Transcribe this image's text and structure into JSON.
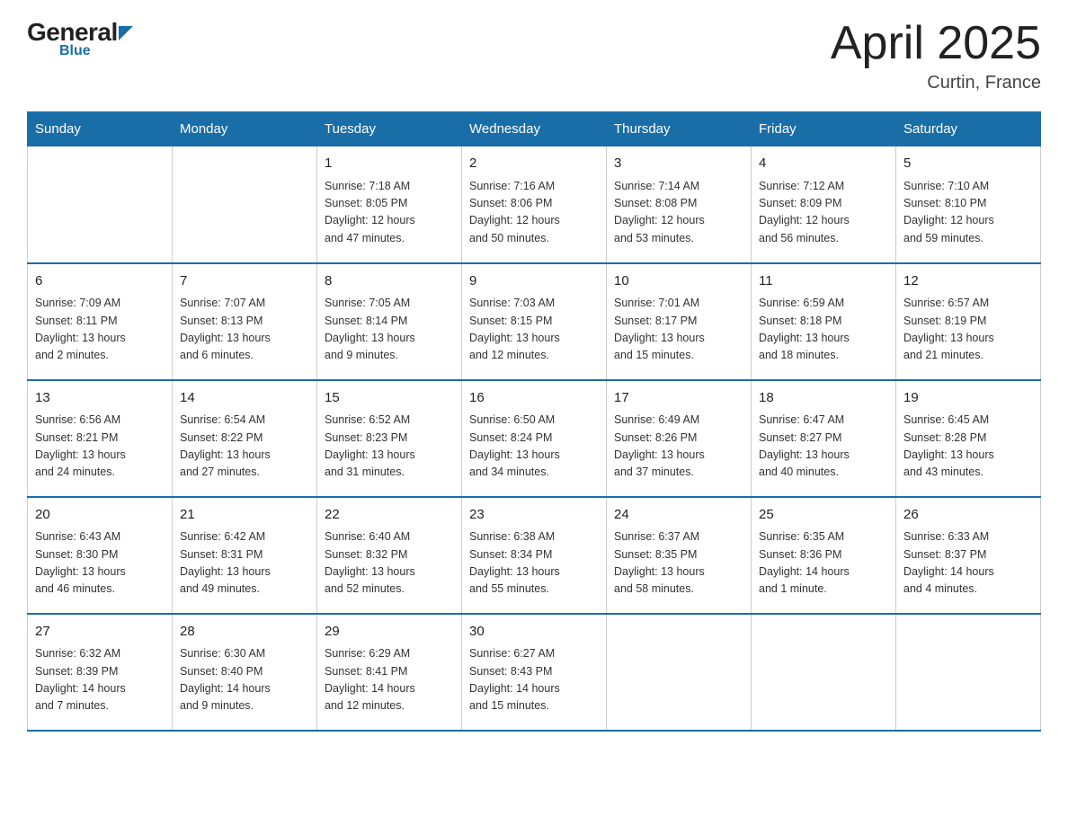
{
  "header": {
    "month_title": "April 2025",
    "location": "Curtin, France"
  },
  "days_of_week": [
    "Sunday",
    "Monday",
    "Tuesday",
    "Wednesday",
    "Thursday",
    "Friday",
    "Saturday"
  ],
  "weeks": [
    [
      {
        "day": "",
        "info": ""
      },
      {
        "day": "",
        "info": ""
      },
      {
        "day": "1",
        "info": "Sunrise: 7:18 AM\nSunset: 8:05 PM\nDaylight: 12 hours\nand 47 minutes."
      },
      {
        "day": "2",
        "info": "Sunrise: 7:16 AM\nSunset: 8:06 PM\nDaylight: 12 hours\nand 50 minutes."
      },
      {
        "day": "3",
        "info": "Sunrise: 7:14 AM\nSunset: 8:08 PM\nDaylight: 12 hours\nand 53 minutes."
      },
      {
        "day": "4",
        "info": "Sunrise: 7:12 AM\nSunset: 8:09 PM\nDaylight: 12 hours\nand 56 minutes."
      },
      {
        "day": "5",
        "info": "Sunrise: 7:10 AM\nSunset: 8:10 PM\nDaylight: 12 hours\nand 59 minutes."
      }
    ],
    [
      {
        "day": "6",
        "info": "Sunrise: 7:09 AM\nSunset: 8:11 PM\nDaylight: 13 hours\nand 2 minutes."
      },
      {
        "day": "7",
        "info": "Sunrise: 7:07 AM\nSunset: 8:13 PM\nDaylight: 13 hours\nand 6 minutes."
      },
      {
        "day": "8",
        "info": "Sunrise: 7:05 AM\nSunset: 8:14 PM\nDaylight: 13 hours\nand 9 minutes."
      },
      {
        "day": "9",
        "info": "Sunrise: 7:03 AM\nSunset: 8:15 PM\nDaylight: 13 hours\nand 12 minutes."
      },
      {
        "day": "10",
        "info": "Sunrise: 7:01 AM\nSunset: 8:17 PM\nDaylight: 13 hours\nand 15 minutes."
      },
      {
        "day": "11",
        "info": "Sunrise: 6:59 AM\nSunset: 8:18 PM\nDaylight: 13 hours\nand 18 minutes."
      },
      {
        "day": "12",
        "info": "Sunrise: 6:57 AM\nSunset: 8:19 PM\nDaylight: 13 hours\nand 21 minutes."
      }
    ],
    [
      {
        "day": "13",
        "info": "Sunrise: 6:56 AM\nSunset: 8:21 PM\nDaylight: 13 hours\nand 24 minutes."
      },
      {
        "day": "14",
        "info": "Sunrise: 6:54 AM\nSunset: 8:22 PM\nDaylight: 13 hours\nand 27 minutes."
      },
      {
        "day": "15",
        "info": "Sunrise: 6:52 AM\nSunset: 8:23 PM\nDaylight: 13 hours\nand 31 minutes."
      },
      {
        "day": "16",
        "info": "Sunrise: 6:50 AM\nSunset: 8:24 PM\nDaylight: 13 hours\nand 34 minutes."
      },
      {
        "day": "17",
        "info": "Sunrise: 6:49 AM\nSunset: 8:26 PM\nDaylight: 13 hours\nand 37 minutes."
      },
      {
        "day": "18",
        "info": "Sunrise: 6:47 AM\nSunset: 8:27 PM\nDaylight: 13 hours\nand 40 minutes."
      },
      {
        "day": "19",
        "info": "Sunrise: 6:45 AM\nSunset: 8:28 PM\nDaylight: 13 hours\nand 43 minutes."
      }
    ],
    [
      {
        "day": "20",
        "info": "Sunrise: 6:43 AM\nSunset: 8:30 PM\nDaylight: 13 hours\nand 46 minutes."
      },
      {
        "day": "21",
        "info": "Sunrise: 6:42 AM\nSunset: 8:31 PM\nDaylight: 13 hours\nand 49 minutes."
      },
      {
        "day": "22",
        "info": "Sunrise: 6:40 AM\nSunset: 8:32 PM\nDaylight: 13 hours\nand 52 minutes."
      },
      {
        "day": "23",
        "info": "Sunrise: 6:38 AM\nSunset: 8:34 PM\nDaylight: 13 hours\nand 55 minutes."
      },
      {
        "day": "24",
        "info": "Sunrise: 6:37 AM\nSunset: 8:35 PM\nDaylight: 13 hours\nand 58 minutes."
      },
      {
        "day": "25",
        "info": "Sunrise: 6:35 AM\nSunset: 8:36 PM\nDaylight: 14 hours\nand 1 minute."
      },
      {
        "day": "26",
        "info": "Sunrise: 6:33 AM\nSunset: 8:37 PM\nDaylight: 14 hours\nand 4 minutes."
      }
    ],
    [
      {
        "day": "27",
        "info": "Sunrise: 6:32 AM\nSunset: 8:39 PM\nDaylight: 14 hours\nand 7 minutes."
      },
      {
        "day": "28",
        "info": "Sunrise: 6:30 AM\nSunset: 8:40 PM\nDaylight: 14 hours\nand 9 minutes."
      },
      {
        "day": "29",
        "info": "Sunrise: 6:29 AM\nSunset: 8:41 PM\nDaylight: 14 hours\nand 12 minutes."
      },
      {
        "day": "30",
        "info": "Sunrise: 6:27 AM\nSunset: 8:43 PM\nDaylight: 14 hours\nand 15 minutes."
      },
      {
        "day": "",
        "info": ""
      },
      {
        "day": "",
        "info": ""
      },
      {
        "day": "",
        "info": ""
      }
    ]
  ]
}
